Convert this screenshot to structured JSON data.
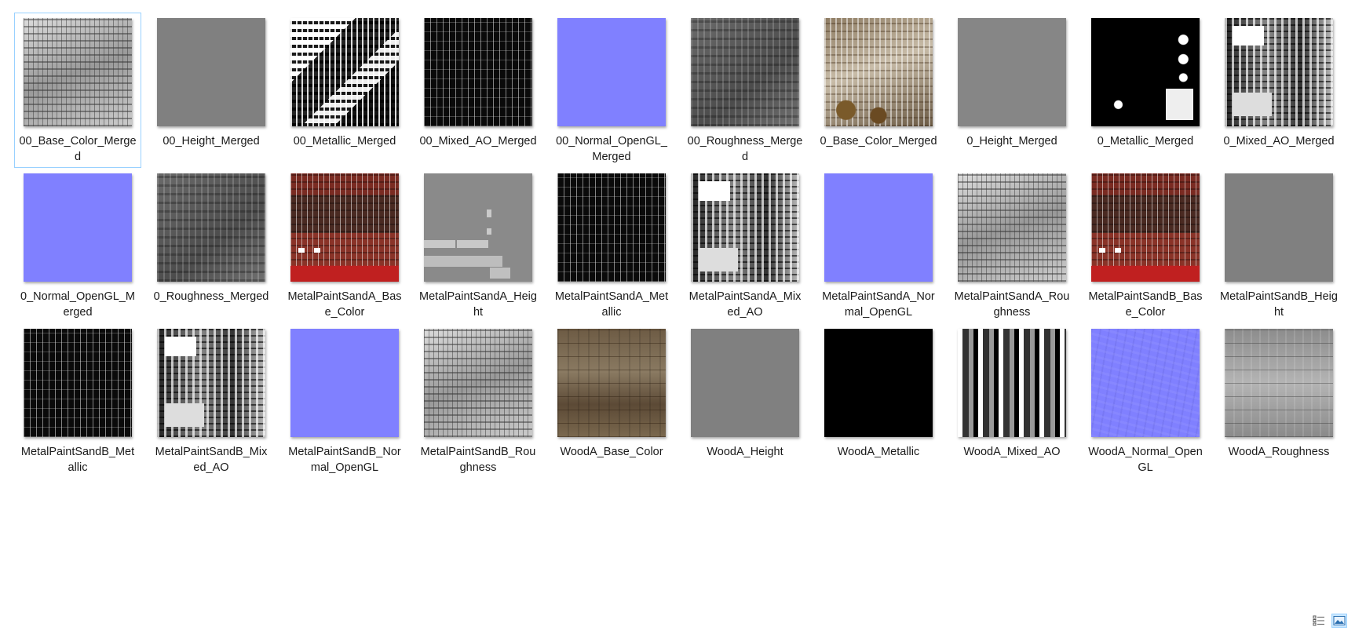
{
  "files": [
    {
      "name": "00_Base_Color_Merged",
      "style": "t-mono-light",
      "selected": true
    },
    {
      "name": "00_Height_Merged",
      "style": "t-gray"
    },
    {
      "name": "00_Metallic_Merged",
      "style": "t-mono-busy"
    },
    {
      "name": "00_Mixed_AO_Merged",
      "style": "t-mono-dark"
    },
    {
      "name": "00_Normal_OpenGL_Merged",
      "style": "t-normal"
    },
    {
      "name": "00_Roughness_Merged",
      "style": "t-mono-mid"
    },
    {
      "name": "0_Base_Color_Merged",
      "style": "t-color-chips"
    },
    {
      "name": "0_Height_Merged",
      "style": "t-gray-light"
    },
    {
      "name": "0_Metallic_Merged",
      "style": "t-mono-metal"
    },
    {
      "name": "0_Mixed_AO_Merged",
      "style": "t-mono-blocks"
    },
    {
      "name": "0_Normal_OpenGL_Merged",
      "style": "t-normal"
    },
    {
      "name": "0_Roughness_Merged",
      "style": "t-mono-mid"
    },
    {
      "name": "MetalPaintSandA_Base_Color",
      "style": "t-redpaint"
    },
    {
      "name": "MetalPaintSandA_Height",
      "style": "t-height-a"
    },
    {
      "name": "MetalPaintSandA_Metallic",
      "style": "t-mono-dark"
    },
    {
      "name": "MetalPaintSandA_Mixed_AO",
      "style": "t-mono-blocks"
    },
    {
      "name": "MetalPaintSandA_Normal_OpenGL",
      "style": "t-normal"
    },
    {
      "name": "MetalPaintSandA_Roughness",
      "style": "t-mono-light"
    },
    {
      "name": "MetalPaintSandB_Base_Color",
      "style": "t-redpaint"
    },
    {
      "name": "MetalPaintSandB_Height",
      "style": "t-gray"
    },
    {
      "name": "MetalPaintSandB_Metallic",
      "style": "t-mono-dark"
    },
    {
      "name": "MetalPaintSandB_Mixed_AO",
      "style": "t-mono-blocks"
    },
    {
      "name": "MetalPaintSandB_Normal_OpenGL",
      "style": "t-normal"
    },
    {
      "name": "MetalPaintSandB_Roughness",
      "style": "t-mono-light"
    },
    {
      "name": "WoodA_Base_Color",
      "style": "t-wood"
    },
    {
      "name": "WoodA_Height",
      "style": "t-gray"
    },
    {
      "name": "WoodA_Metallic",
      "style": "t-black"
    },
    {
      "name": "WoodA_Mixed_AO",
      "style": "t-stripes-ao"
    },
    {
      "name": "WoodA_Normal_OpenGL",
      "style": "t-normal-noisy"
    },
    {
      "name": "WoodA_Roughness",
      "style": "t-wood-rough"
    }
  ],
  "status_bar": {
    "details_view_icon": "details-view-icon",
    "large_icons_view_icon": "large-icons-view-icon",
    "active_view": "large-icons"
  }
}
